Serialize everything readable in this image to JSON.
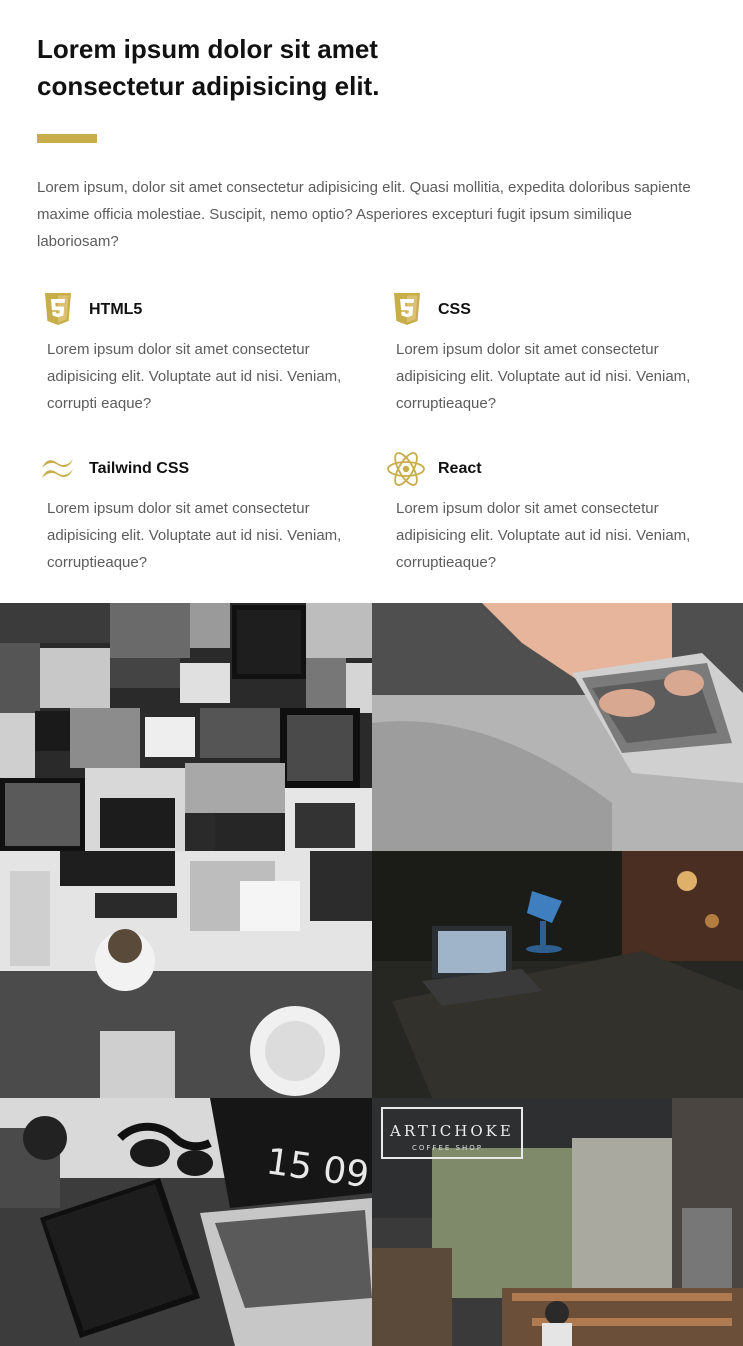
{
  "header": {
    "title": "Lorem ipsum dolor sit amet consectetur adipisicing elit.",
    "lead": "Lorem ipsum, dolor sit amet consectetur adipisicing elit. Quasi mollitia, expedita doloribus sapiente maxime officia molestiae. Suscipit, nemo optio? Asperiores excepturi fugit ipsum similique laboriosam?"
  },
  "colors": {
    "accent": "#c8ad4b",
    "text": "#111111",
    "muted": "#5c5c5c"
  },
  "features": [
    {
      "icon": "html5-icon",
      "title": "HTML5",
      "desc": "Lorem ipsum dolor sit amet consectetur adipisicing elit. Voluptate aut id nisi. Veniam, corrupti eaque?"
    },
    {
      "icon": "css3-icon",
      "title": "CSS",
      "desc": "Lorem ipsum dolor sit amet consectetur adipisicing elit. Voluptate aut id nisi. Veniam, corruptieaque?"
    },
    {
      "icon": "tailwind-icon",
      "title": "Tailwind CSS",
      "desc": "Lorem ipsum dolor sit amet consectetur adipisicing elit. Voluptate aut id nisi. Veniam, corruptieaque?"
    },
    {
      "icon": "react-icon",
      "title": "React",
      "desc": "Lorem ipsum dolor sit amet consectetur adipisicing elit. Voluptate aut id nisi. Veniam, corruptieaque?"
    }
  ],
  "gallery": {
    "clock_text": "15 09",
    "sign_text": "ARTICHOKE",
    "sign_subtext": "COFFEE SHOP"
  }
}
